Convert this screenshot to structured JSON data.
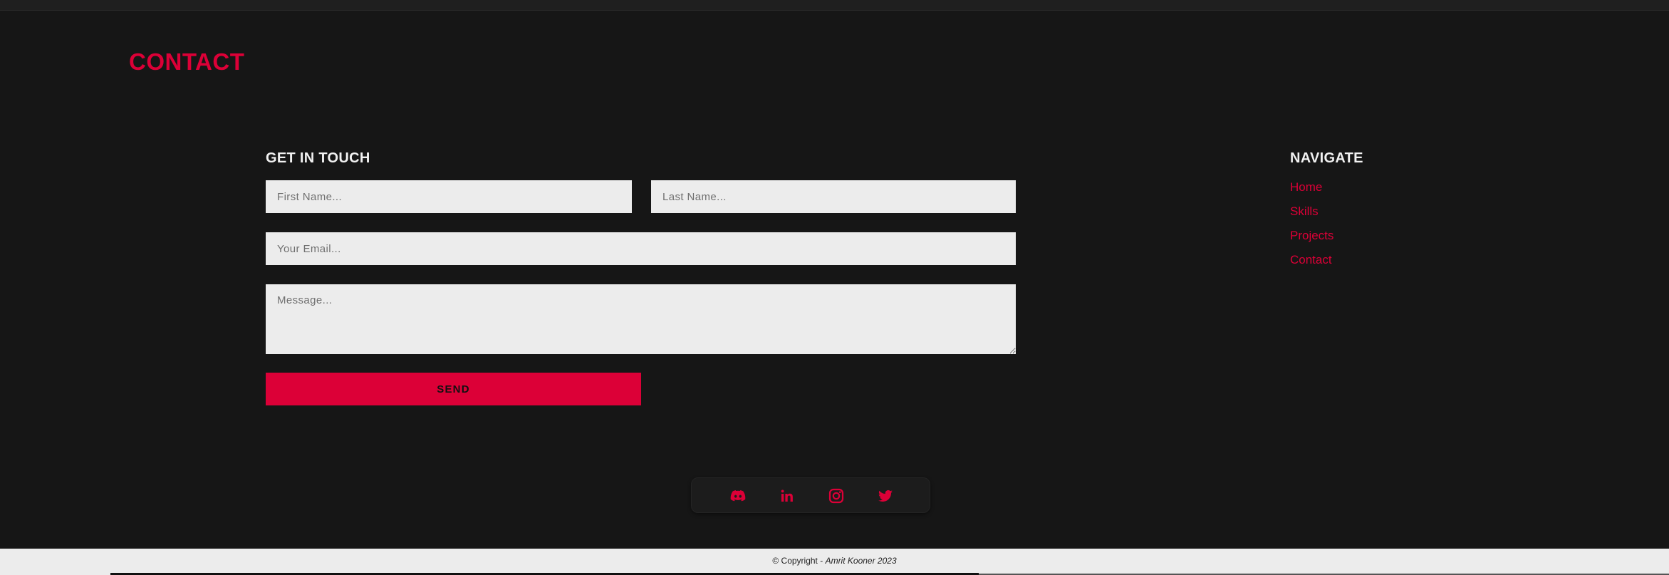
{
  "section": {
    "title": "CONTACT"
  },
  "form": {
    "heading": "GET IN TOUCH",
    "first_name_placeholder": "First Name...",
    "last_name_placeholder": "Last Name...",
    "email_placeholder": "Your Email...",
    "message_placeholder": "Message...",
    "send_label": "SEND"
  },
  "navigate": {
    "heading": "NAVIGATE",
    "links": [
      {
        "label": "Home"
      },
      {
        "label": "Skills"
      },
      {
        "label": "Projects"
      },
      {
        "label": "Contact"
      }
    ]
  },
  "social": {
    "icons": [
      "discord-icon",
      "linkedin-icon",
      "instagram-icon",
      "twitter-icon"
    ]
  },
  "footer": {
    "copyright_prefix": "© Copyright - ",
    "author": "Amrit Kooner 2023"
  },
  "colors": {
    "accent": "#dc0037",
    "background": "#161616",
    "field_background": "#ececec"
  }
}
